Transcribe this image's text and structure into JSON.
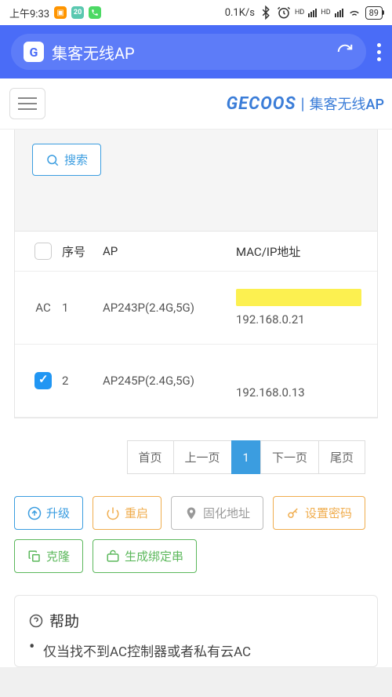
{
  "status": {
    "time": "上午9:33",
    "calendar": "20",
    "speed": "0.1K/s",
    "battery": "89"
  },
  "browser": {
    "title": "集客无线AP"
  },
  "brand": {
    "logo": "GECOOS",
    "text": "集客无线AP"
  },
  "search": {
    "label": "搜索"
  },
  "table": {
    "headers": {
      "seq": "序号",
      "ap": "AP",
      "mac": "MAC/IP地址"
    },
    "rows": [
      {
        "tag": "AC",
        "seq": "1",
        "ap": "AP243P(2.4G,5G)",
        "ip": "192.168.0.21",
        "checked": false,
        "redacted": "yellow"
      },
      {
        "tag": "",
        "seq": "2",
        "ap": "AP245P(2.4G,5G)",
        "ip": "192.168.0.13",
        "checked": true,
        "redacted": "white"
      }
    ]
  },
  "pagination": {
    "first": "首页",
    "prev": "上一页",
    "current": "1",
    "next": "下一页",
    "last": "尾页"
  },
  "actions": {
    "upgrade": "升级",
    "reboot": "重启",
    "fixaddr": "固化地址",
    "setpwd": "设置密码",
    "clone": "克隆",
    "genbind": "生成绑定串"
  },
  "help": {
    "title": "帮助",
    "item1": "仅当找不到AC控制器或者私有云AC"
  }
}
